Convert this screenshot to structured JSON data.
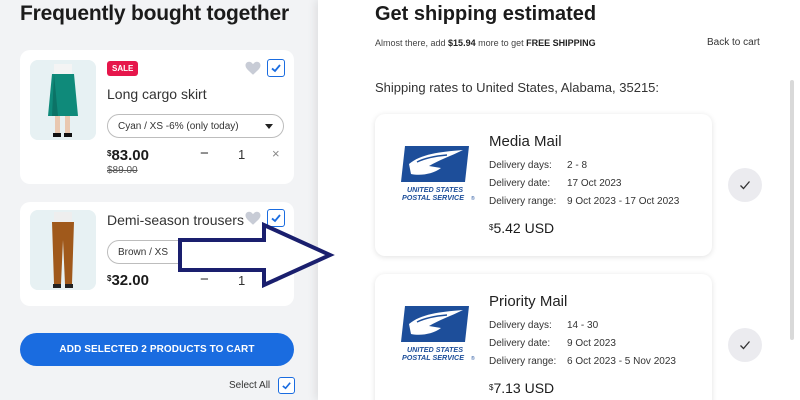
{
  "left": {
    "title": "Frequently bought together",
    "products": [
      {
        "badge": "SALE",
        "name": "Long cargo skirt",
        "variant": "Cyan / XS -6% (only today)",
        "currency": "$",
        "price": "83.00",
        "old_price": "$89.00",
        "qty": "1",
        "minus": "−",
        "action": "×",
        "image": "green-cargo-skirt-photo"
      },
      {
        "name": "Demi-season trousers",
        "variant": "Brown / XS",
        "currency": "$",
        "price": "32.00",
        "qty": "1",
        "minus": "−",
        "action": "+",
        "image": "brown-trousers-photo"
      }
    ],
    "add_button": "ADD SELECTED 2 PRODUCTS TO CART",
    "select_all": "Select All"
  },
  "right": {
    "title": "Get shipping estimated",
    "note_prefix": "Almost there, add ",
    "note_amount": "$15.94",
    "note_middle": " more to get ",
    "note_free": "FREE SHIPPING",
    "back_link": "Back to cart",
    "rates_to": "Shipping rates to United States, Alabama, 35215:",
    "logo_line1": "UNITED STATES",
    "logo_line2": "POSTAL SERVICE",
    "logo_reg": "®",
    "labels": {
      "days": "Delivery days:",
      "date": "Delivery date:",
      "range": "Delivery range:"
    },
    "rates": [
      {
        "method": "Media Mail",
        "days": "2 - 8",
        "date": "17 Oct 2023",
        "range": "9 Oct 2023 - 17 Oct 2023",
        "currency": "$",
        "price": "5.42 USD"
      },
      {
        "method": "Priority Mail",
        "days": "14 - 30",
        "date": "9 Oct 2023",
        "range": "6 Oct 2023 - 5 Nov 2023",
        "currency": "$",
        "price": "7.13 USD"
      }
    ]
  },
  "colors": {
    "accent": "#1a6ce0",
    "sale": "#e6164b",
    "usps_blue": "#1d4e9a",
    "arrow": "#1a1f6e"
  },
  "icons": [
    "heart-icon",
    "checkmark-icon",
    "caret-down-icon",
    "usps-eagle-logo",
    "right-arrow"
  ]
}
